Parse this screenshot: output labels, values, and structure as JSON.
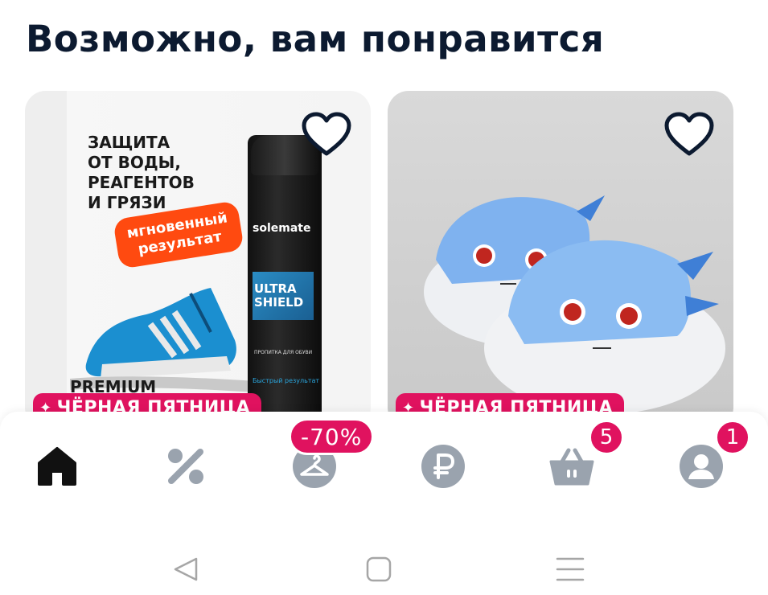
{
  "section": {
    "title": "Возможно, вам понравится"
  },
  "products": [
    {
      "poster_lines": [
        "ЗАЩИТА",
        "ОТ ВОДЫ,",
        "РЕАГЕНТОВ",
        "И ГРЯЗИ"
      ],
      "result_lines": [
        "мгновенный",
        "результат"
      ],
      "premium": "PREMIUM",
      "can_brand": "solemate",
      "can_name_lines": [
        "ULTRA",
        "SHIELD"
      ],
      "can_small": "ПРОПИТКА ДЛЯ ОБУВИ",
      "can_accent": "Быстрый результат",
      "badge": "ЧЁРНАЯ ПЯТНИЦА",
      "favorite_icon": "heart-outline"
    },
    {
      "badge": "ЧЁРНАЯ ПЯТНИЦА",
      "favorite_icon": "heart-outline"
    }
  ],
  "nav": {
    "items": [
      {
        "icon": "home-icon",
        "active": true
      },
      {
        "icon": "percent-icon"
      },
      {
        "icon": "hanger-icon",
        "badge": "-70%"
      },
      {
        "icon": "ruble-icon"
      },
      {
        "icon": "basket-icon",
        "badge": "5"
      },
      {
        "icon": "profile-icon",
        "badge": "1"
      }
    ],
    "active_color": "#111111",
    "inactive_color": "#9aa3ae",
    "badge_color": "#e0125f"
  },
  "system_nav": [
    "back-icon",
    "home-square-icon",
    "recents-icon"
  ]
}
